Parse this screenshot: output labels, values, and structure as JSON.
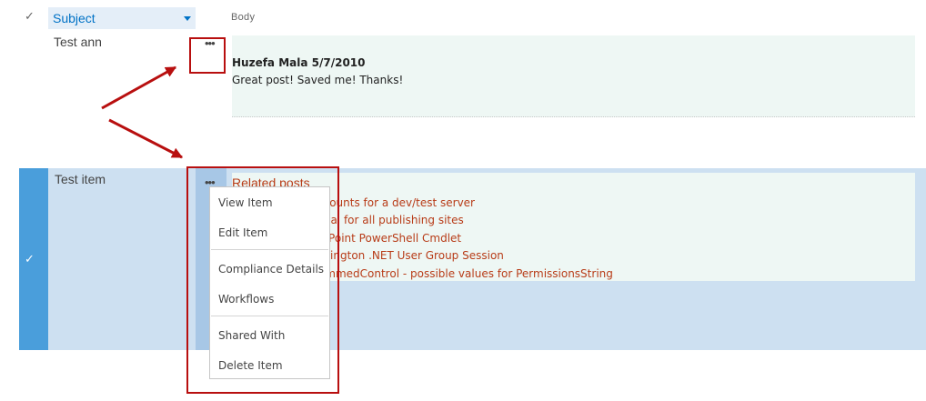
{
  "header": {
    "check_glyph": "✓",
    "subject_label": "Subject",
    "body_label": "Body"
  },
  "row1": {
    "subject": "Test ann",
    "ellipsis": "•••",
    "comment_author": "Huzefa Mala  5/7/2010",
    "comment_text": "Great post! Saved me! Thanks!"
  },
  "row2": {
    "subject": "Test item",
    "ellipsis": "•••",
    "selected_glyph": "✓",
    "related_title": "Related posts",
    "related_links": [
      "ccounts for a dev/test server",
      "oval for all publishing sites",
      "rePoint PowerShell Cmdlet",
      "ellington .NET User Group Session",
      "rimmedControl - possible values for PermissionsString"
    ]
  },
  "context_menu": {
    "items": [
      "View Item",
      "Edit Item",
      "Compliance Details",
      "Workflows",
      "Shared With",
      "Delete Item"
    ]
  },
  "colors": {
    "selected_row": "#cde0f1",
    "selection_bar": "#4a9edb",
    "link": "#b83c18",
    "annotation": "#b80f0f"
  }
}
